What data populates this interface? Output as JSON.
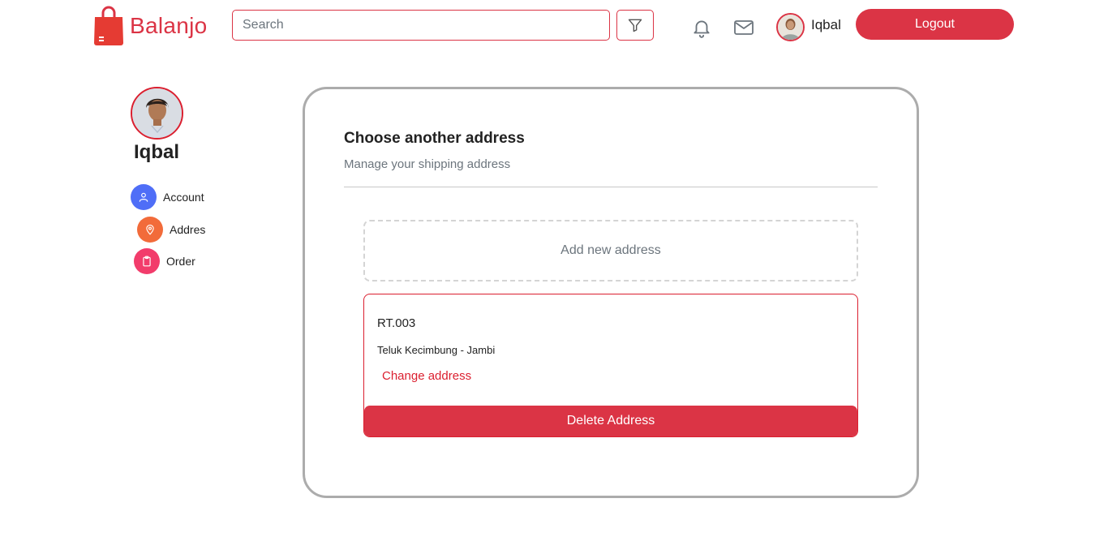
{
  "brand": {
    "name": "Balanjo",
    "color": "#db3445"
  },
  "header": {
    "search_placeholder": "Search",
    "search_value": "",
    "user_name": "Iqbal",
    "logout_label": "Logout",
    "icons": [
      "filter-icon",
      "bell-icon",
      "mail-icon"
    ]
  },
  "sidebar": {
    "user_name": "Iqbal",
    "items": [
      {
        "label": "Account",
        "icon": "user-icon",
        "color": "#4f6ef7"
      },
      {
        "label": "Addres",
        "icon": "map-pin-icon",
        "color": "#f26b3a"
      },
      {
        "label": "Order",
        "icon": "clipboard-icon",
        "color": "#f23c6b"
      }
    ]
  },
  "main": {
    "title": "Choose another address",
    "subtitle": "Manage your shipping address",
    "add_new_label": "Add new address",
    "address": {
      "name": "RT.003",
      "detail": "Teluk Kecimbung - Jambi",
      "change_label": "Change address",
      "delete_label": "Delete Address"
    }
  }
}
